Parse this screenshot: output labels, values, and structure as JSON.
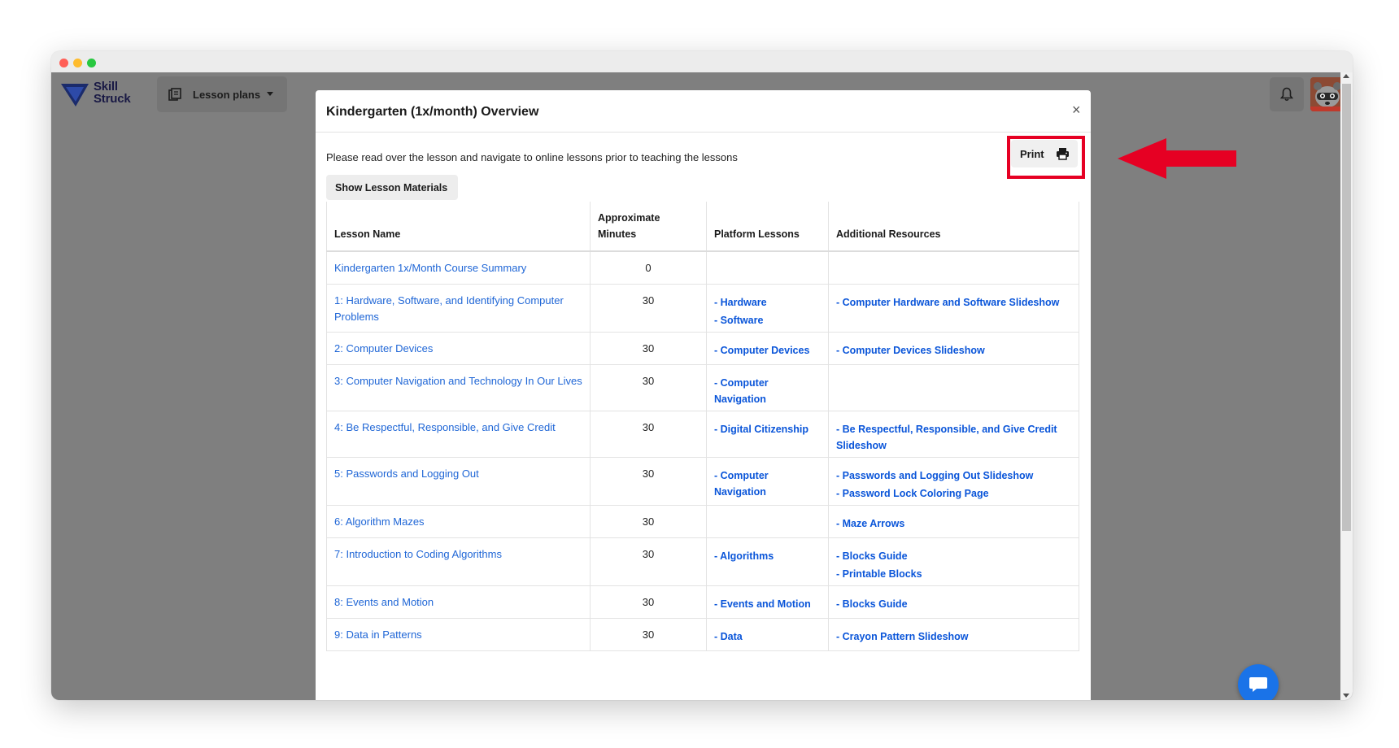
{
  "app": {
    "logo_line1": "Skill",
    "logo_line2": "Struck",
    "nav_menu_label": "Lesson plans"
  },
  "modal": {
    "title": "Kindergarten (1x/month) Overview",
    "close_label": "×",
    "intro": "Please read over the lesson and navigate to online lessons prior to teaching the lessons",
    "print_label": "Print",
    "materials_label": "Show Lesson Materials",
    "columns": [
      "Lesson Name",
      "Approximate Minutes",
      "Platform Lessons",
      "Additional Resources"
    ],
    "rows": [
      {
        "name": "Kindergarten 1x/Month Course Summary",
        "minutes": "0",
        "platform": [],
        "resources": []
      },
      {
        "name": "1: Hardware, Software, and Identifying Computer Problems",
        "minutes": "30",
        "platform": [
          "- Hardware",
          "- Software"
        ],
        "resources": [
          "- Computer Hardware and Software Slideshow"
        ]
      },
      {
        "name": "2: Computer Devices",
        "minutes": "30",
        "platform": [
          "- Computer Devices"
        ],
        "resources": [
          "- Computer Devices Slideshow"
        ]
      },
      {
        "name": "3: Computer Navigation and Technology In Our Lives",
        "minutes": "30",
        "platform": [
          "- Computer Navigation"
        ],
        "resources": []
      },
      {
        "name": "4: Be Respectful, Responsible, and Give Credit",
        "minutes": "30",
        "platform": [
          "- Digital Citizenship"
        ],
        "resources": [
          "- Be Respectful, Responsible, and Give Credit Slideshow"
        ]
      },
      {
        "name": "5: Passwords and Logging Out",
        "minutes": "30",
        "platform": [
          "- Computer Navigation"
        ],
        "resources": [
          "- Passwords and Logging Out Slideshow",
          "- Password Lock Coloring Page"
        ]
      },
      {
        "name": "6: Algorithm Mazes",
        "minutes": "30",
        "platform": [],
        "resources": [
          "- Maze Arrows"
        ]
      },
      {
        "name": "7: Introduction to Coding Algorithms",
        "minutes": "30",
        "platform": [
          "- Algorithms"
        ],
        "resources": [
          "- Blocks Guide",
          "- Printable Blocks"
        ]
      },
      {
        "name": "8: Events and Motion",
        "minutes": "30",
        "platform": [
          "- Events and Motion"
        ],
        "resources": [
          "- Blocks Guide"
        ]
      },
      {
        "name": "9: Data in Patterns",
        "minutes": "30",
        "platform": [
          "- Data"
        ],
        "resources": [
          "- Crayon Pattern Slideshow"
        ]
      }
    ]
  },
  "icons": {
    "logo": "skill-struck-logo-icon",
    "menu": "book-stack-icon",
    "print": "printer-icon",
    "bell": "bell-icon",
    "chat": "chat-bubble-icon",
    "annotation": "red-arrow-icon"
  },
  "colors": {
    "link": "#1f66d6",
    "bold_link": "#0a55d9",
    "highlight": "#e60023",
    "overlay": "#7f7f7f",
    "chat": "#1a73e8"
  }
}
